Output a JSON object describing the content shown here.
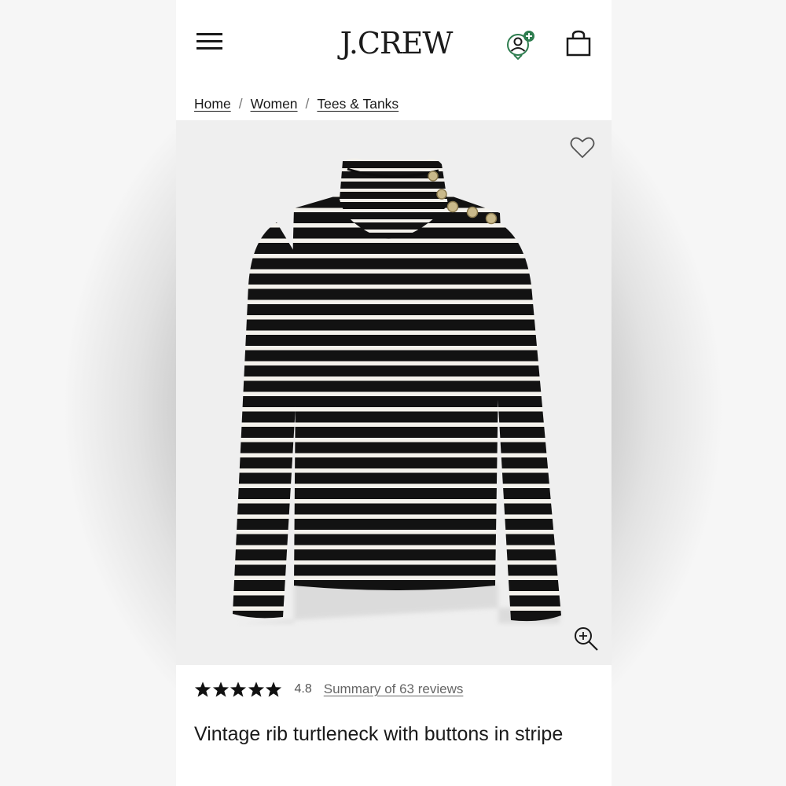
{
  "header": {
    "brand": "J.CREW",
    "menu_icon": "hamburger-menu-icon",
    "account_icon": "account-add-icon",
    "bag_icon": "shopping-bag-icon",
    "accent_color": "#2e7d4f"
  },
  "breadcrumb": [
    "Home",
    "Women",
    "Tees & Tanks"
  ],
  "product": {
    "image_description_icon": "product-image",
    "wishlist_icon": "heart-icon",
    "zoom_icon": "zoom-in-icon",
    "rating": {
      "stars": 5,
      "value": "4.8",
      "reviews_link": "Summary of 63 reviews"
    },
    "title": "Vintage rib turtleneck with buttons in stripe"
  }
}
